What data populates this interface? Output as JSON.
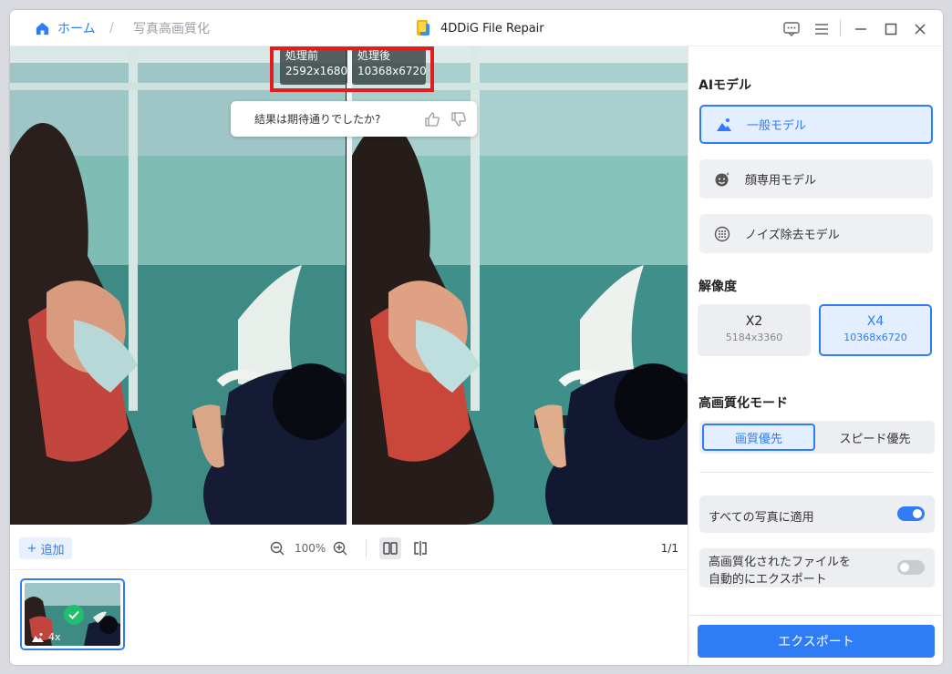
{
  "breadcrumb": {
    "home": "ホーム",
    "separator": "/",
    "page": "写真高画質化"
  },
  "app": {
    "title": "4DDiG File Repair"
  },
  "titlebar_icons": [
    "feedback-icon",
    "menu-icon",
    "minimize-icon",
    "maximize-icon",
    "close-icon"
  ],
  "preview": {
    "before_label": "処理前",
    "before_size": "2592x1680",
    "after_label": "処理後",
    "after_size": "10368x6720",
    "feedback_question": "結果は期待通りでしたか?"
  },
  "toolbar": {
    "add_label": "追加",
    "zoom_level": "100%",
    "page_indicator": "1/1"
  },
  "thumbnail": {
    "scale_label": "4x"
  },
  "panel": {
    "ai_model_title": "AIモデル",
    "models": [
      {
        "label": "一般モデル",
        "active": true
      },
      {
        "label": "顔専用モデル",
        "active": false
      },
      {
        "label": "ノイズ除去モデル",
        "active": false
      }
    ],
    "resolution_title": "解像度",
    "resolutions": [
      {
        "label": "X2",
        "size": "5184x3360",
        "active": false
      },
      {
        "label": "X4",
        "size": "10368x6720",
        "active": true
      }
    ],
    "mode_title": "高画質化モード",
    "modes": [
      {
        "label": "画質優先",
        "active": true
      },
      {
        "label": "スピード優先",
        "active": false
      }
    ],
    "apply_all_label": "すべての写真に適用",
    "apply_all_on": true,
    "auto_export_label_line1": "高画質化されたファイルを",
    "auto_export_label_line2": "自動的にエクスポート",
    "auto_export_on": false,
    "export_label": "エクスポート"
  },
  "colors": {
    "accent": "#2f7df6",
    "success": "#1fbf6c",
    "highlight": "#e31d1d"
  }
}
